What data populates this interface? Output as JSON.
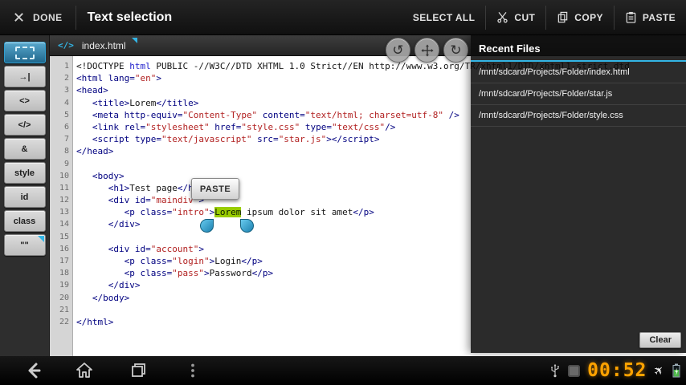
{
  "action_bar": {
    "done_label": "DONE",
    "title": "Text selection",
    "actions": [
      {
        "id": "select-all",
        "label": "SELECT ALL"
      },
      {
        "id": "cut",
        "label": "CUT"
      },
      {
        "id": "copy",
        "label": "COPY"
      },
      {
        "id": "paste",
        "label": "PASTE"
      }
    ]
  },
  "tab_bar": {
    "icon_glyph": "</>",
    "file_name": "index.html"
  },
  "sidebar": {
    "keys": [
      {
        "id": "selection-mode",
        "icon": "selection",
        "active": true,
        "label": ""
      },
      {
        "id": "tab",
        "label": "→|"
      },
      {
        "id": "open-tag",
        "label": "<>"
      },
      {
        "id": "close-tag",
        "label": "</>"
      },
      {
        "id": "ampersand",
        "label": "&"
      },
      {
        "id": "style",
        "label": "style"
      },
      {
        "id": "id",
        "label": "id"
      },
      {
        "id": "class",
        "label": "class"
      },
      {
        "id": "quotes",
        "label": "\"\"",
        "corner_badge": true
      }
    ]
  },
  "editor": {
    "selection_popup": "PASTE",
    "selected_text": "Lorem",
    "lines": [
      {
        "n": 1,
        "ind": 0,
        "tk": [
          [
            "p",
            "<!DOCTYPE "
          ],
          [
            "k",
            "html"
          ],
          [
            "p",
            " PUBLIC -//W3C//DTD XHTML 1.0 Strict//EN http://www.w3.org/TR/xhtml1/DTD/xhtml1-strict.dtd"
          ]
        ]
      },
      {
        "n": 2,
        "ind": 0,
        "tk": [
          [
            "t",
            "<html lang="
          ],
          [
            "s",
            "\"en\""
          ],
          [
            "t",
            ">"
          ]
        ]
      },
      {
        "n": 3,
        "ind": 0,
        "tk": [
          [
            "t",
            "<head>"
          ]
        ]
      },
      {
        "n": 4,
        "ind": 3,
        "tk": [
          [
            "t",
            "<title>"
          ],
          [
            "p",
            "Lorem"
          ],
          [
            "t",
            "</title>"
          ]
        ]
      },
      {
        "n": 5,
        "ind": 3,
        "tk": [
          [
            "t",
            "<meta http-equiv="
          ],
          [
            "s",
            "\"Content-Type\""
          ],
          [
            "t",
            " content="
          ],
          [
            "s",
            "\"text/html; charset=utf-8\""
          ],
          [
            "t",
            " />"
          ]
        ]
      },
      {
        "n": 6,
        "ind": 3,
        "tk": [
          [
            "t",
            "<link rel="
          ],
          [
            "s",
            "\"stylesheet\""
          ],
          [
            "t",
            " href="
          ],
          [
            "s",
            "\"style.css\""
          ],
          [
            "t",
            " type="
          ],
          [
            "s",
            "\"text/css\""
          ],
          [
            "t",
            "/>"
          ]
        ]
      },
      {
        "n": 7,
        "ind": 3,
        "tk": [
          [
            "t",
            "<script type="
          ],
          [
            "s",
            "\"text/javascript\""
          ],
          [
            "t",
            " src="
          ],
          [
            "s",
            "\"star.js\""
          ],
          [
            "t",
            "></script>"
          ]
        ]
      },
      {
        "n": 8,
        "ind": 0,
        "tk": [
          [
            "t",
            "</head>"
          ]
        ]
      },
      {
        "n": 9,
        "ind": 0,
        "tk": []
      },
      {
        "n": 10,
        "ind": 3,
        "tk": [
          [
            "t",
            "<body>"
          ]
        ]
      },
      {
        "n": 11,
        "ind": 6,
        "tk": [
          [
            "t",
            "<h1>"
          ],
          [
            "p",
            "Test page"
          ],
          [
            "t",
            "</h1>"
          ]
        ]
      },
      {
        "n": 12,
        "ind": 6,
        "tk": [
          [
            "t",
            "<div id="
          ],
          [
            "s",
            "\"maindiv\""
          ],
          [
            "t",
            ">"
          ]
        ]
      },
      {
        "n": 13,
        "ind": 9,
        "tk": [
          [
            "t",
            "<p class="
          ],
          [
            "s",
            "\"intro\""
          ],
          [
            "t",
            ">"
          ],
          [
            "sel",
            "Lorem"
          ],
          [
            "p",
            " ipsum dolor sit amet"
          ],
          [
            "t",
            "</p>"
          ]
        ]
      },
      {
        "n": 14,
        "ind": 6,
        "tk": [
          [
            "t",
            "</div>"
          ]
        ]
      },
      {
        "n": 15,
        "ind": 0,
        "tk": []
      },
      {
        "n": 16,
        "ind": 6,
        "tk": [
          [
            "t",
            "<div id="
          ],
          [
            "s",
            "\"account\""
          ],
          [
            "t",
            ">"
          ]
        ]
      },
      {
        "n": 17,
        "ind": 9,
        "tk": [
          [
            "t",
            "<p class="
          ],
          [
            "s",
            "\"login\""
          ],
          [
            "t",
            ">"
          ],
          [
            "p",
            "Login"
          ],
          [
            "t",
            "</p>"
          ]
        ]
      },
      {
        "n": 18,
        "ind": 9,
        "tk": [
          [
            "t",
            "<p class="
          ],
          [
            "s",
            "\"pass\""
          ],
          [
            "t",
            ">"
          ],
          [
            "p",
            "Password"
          ],
          [
            "t",
            "</p>"
          ]
        ]
      },
      {
        "n": 19,
        "ind": 6,
        "tk": [
          [
            "t",
            "</div>"
          ]
        ]
      },
      {
        "n": 20,
        "ind": 3,
        "tk": [
          [
            "t",
            "</body>"
          ]
        ]
      },
      {
        "n": 21,
        "ind": 0,
        "tk": []
      },
      {
        "n": 22,
        "ind": 0,
        "tk": [
          [
            "t",
            "</html>"
          ]
        ]
      }
    ]
  },
  "recent_files": {
    "title": "Recent Files",
    "items": [
      "/mnt/sdcard/Projects/Folder/index.html",
      "/mnt/sdcard/Projects/Folder/star.js",
      "/mnt/sdcard/Projects/Folder/style.css"
    ],
    "clear_label": "Clear"
  },
  "status_bar": {
    "clock": "00:52"
  },
  "icons": {
    "undo": "↺",
    "redo": "↻",
    "airplane": "✈"
  },
  "colors": {
    "accent": "#33b5e5",
    "selection_bg": "#99cc00",
    "clock": "#ffa200",
    "syntax_tag": "#000080",
    "syntax_string": "#b22222",
    "syntax_keyword": "#2020cc",
    "syntax_text": "#141414"
  }
}
